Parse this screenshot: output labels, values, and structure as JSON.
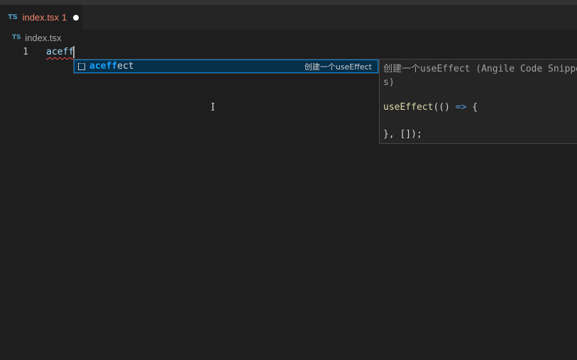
{
  "tab": {
    "lang_badge": "TS",
    "title": "index.tsx",
    "problem_count": "1"
  },
  "breadcrumb": {
    "lang_badge": "TS",
    "file": "index.tsx"
  },
  "editor": {
    "line_number": "1",
    "code_text": "aceff"
  },
  "suggest": {
    "label_match": "aceff",
    "label_rest": "ect",
    "detail": "创建一个useEffect"
  },
  "docs": {
    "title": "创建一个useEffect (Angile Code Snippets)",
    "code_line1_fn": "useEffect",
    "code_line1_open": "(()",
    "code_line1_arrow": "=>",
    "code_line1_brace": "{",
    "code_line3": "}, []);"
  },
  "colors": {
    "editor_bg": "#1e1e1e",
    "tab_error_text": "#f48771",
    "ts_icon": "#519aba",
    "suggest_match": "#18a3ff",
    "suggest_selected_bg": "#062f4a"
  }
}
